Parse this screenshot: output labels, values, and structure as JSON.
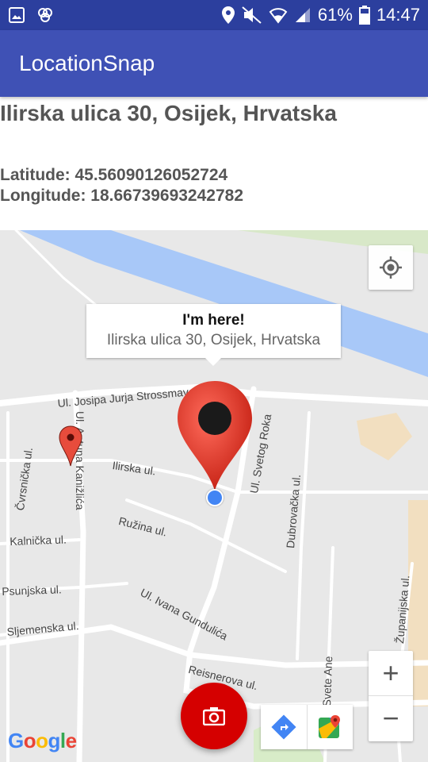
{
  "status": {
    "battery": "61%",
    "time": "14:47"
  },
  "app": {
    "title": "LocationSnap"
  },
  "location": {
    "address": "Ilirska ulica 30, Osijek, Hrvatska",
    "latitude": "Latitude: 45.56090126052724",
    "longitude": "Longitude: 18.66739693242782"
  },
  "map": {
    "info_title": "I'm here!",
    "info_snippet": "Ilirska ulica 30, Osijek, Hrvatska",
    "zoom_in": "+",
    "zoom_out": "−",
    "brand": [
      "G",
      "o",
      "o",
      "g",
      "l",
      "e"
    ],
    "streets": {
      "strossmayer": "Ul. Josipa Jurja Strossmayera",
      "kanizlica": "Ul. Antuna Kanižlića",
      "cvrsnicka": "Čvrsnička ul.",
      "ilirska": "Ilirska ul.",
      "svetog_roka": "Ul. Svetog Roka",
      "dubrovacka": "Dubrovačka ul.",
      "ruzina": "Ružina ul.",
      "kalnicka": "Kalnička ul.",
      "psunjska": "Psunjska ul.",
      "gunduliceva": "Ul. Ivana Gundulića",
      "sljemenska": "Sljemenska ul.",
      "reisnerova": "Reisnerova ul.",
      "zupanijska": "Županijska ul.",
      "svete_ane": "Svete Ane"
    }
  },
  "colors": {
    "status_bar": "#2c3f9e",
    "app_bar": "#3f51b5",
    "fab": "#d50000",
    "river": "#a8c8f8"
  }
}
